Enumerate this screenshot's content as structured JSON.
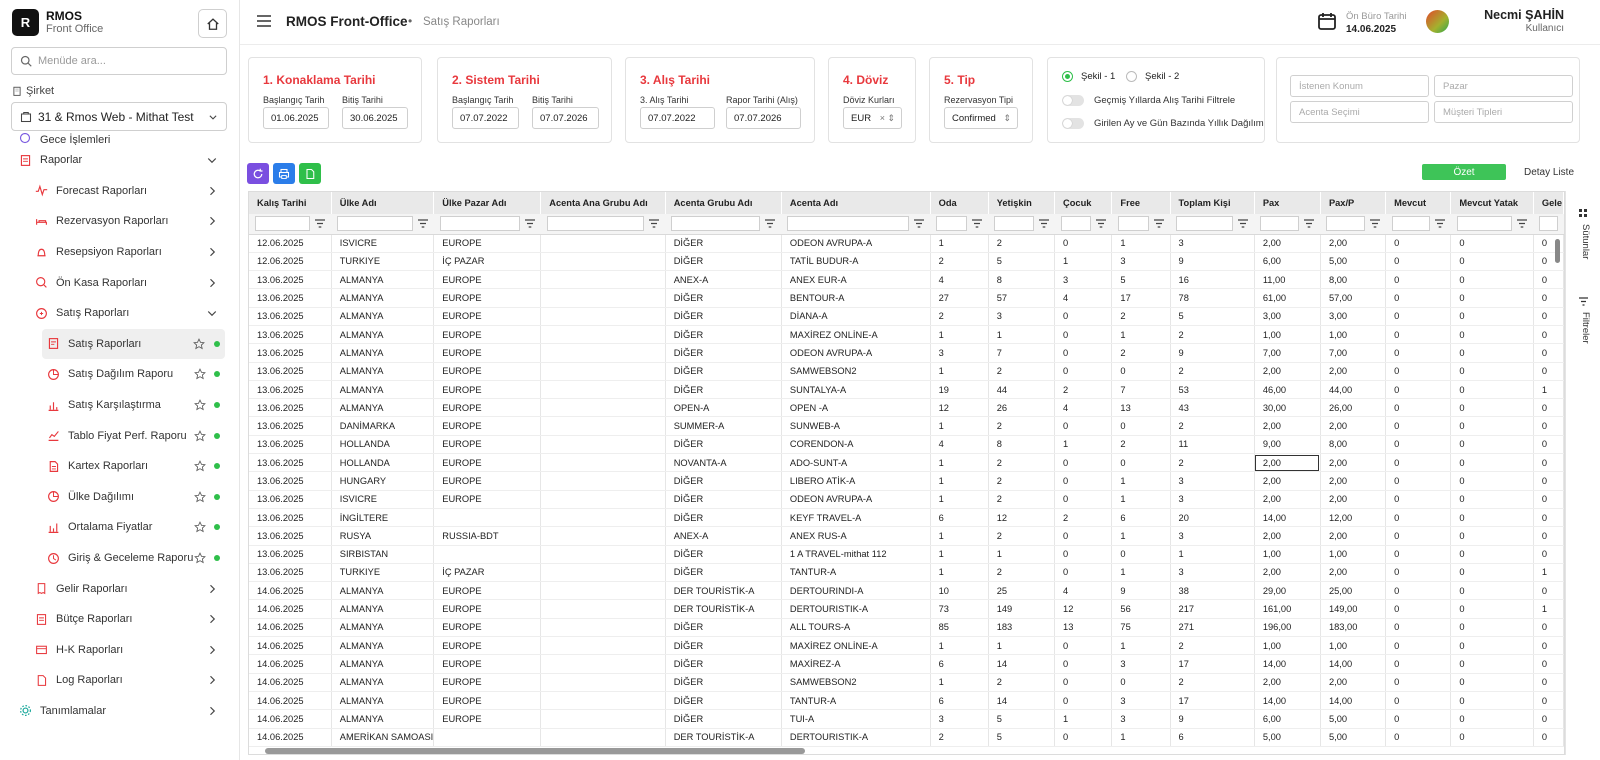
{
  "brand": {
    "logo_letter": "R",
    "title": "RMOS",
    "subtitle": "Front Office"
  },
  "sidebar": {
    "search_placeholder": "Menüde ara...",
    "company_label": "Şirket",
    "company_value": "31 & Rmos Web - Mithat Test",
    "partial_item": "Gece İşlemleri",
    "items": [
      {
        "label": "Raporlar",
        "icon": "report-icon"
      },
      {
        "label": "Forecast Raporları",
        "icon": "chart-line-icon"
      },
      {
        "label": "Rezervasyon Raporları",
        "icon": "bed-icon"
      },
      {
        "label": "Resepsiyon Raporları",
        "icon": "bell-icon"
      },
      {
        "label": "Ön Kasa Raporları",
        "icon": "cash-icon"
      },
      {
        "label": "Satış Raporları",
        "icon": "sales-icon"
      },
      {
        "label": "Satış Raporları",
        "icon": "report-doc-icon"
      },
      {
        "label": "Satış Dağılım Raporu",
        "icon": "pie-icon"
      },
      {
        "label": "Satış Karşılaştırma",
        "icon": "bar-chart-icon"
      },
      {
        "label": "Tablo Fiyat Perf. Raporu",
        "icon": "line-chart-icon"
      },
      {
        "label": "Kartex Raporları",
        "icon": "doc-icon"
      },
      {
        "label": "Ülke Dağılımı",
        "icon": "pie-icon"
      },
      {
        "label": "Ortalama Fiyatlar",
        "icon": "bar-chart-icon"
      },
      {
        "label": "Giriş & Geceleme Raporu",
        "icon": "clock-icon"
      },
      {
        "label": "Gelir Raporları",
        "icon": "receipt-icon"
      },
      {
        "label": "Bütçe Raporları",
        "icon": "wallet-icon"
      },
      {
        "label": "H-K Raporları",
        "icon": "broom-icon"
      },
      {
        "label": "Log Raporları",
        "icon": "log-icon"
      },
      {
        "label": "Tanımlamalar",
        "icon": "gear-icon"
      }
    ]
  },
  "header": {
    "title": "RMOS Front-Office",
    "separator": "•",
    "subtitle": "Satış Raporları",
    "onburo_label": "Ön Büro Tarihi",
    "onburo_date": "14.06.2025",
    "user_name": "Necmi ŞAHİN",
    "user_role": "Kullanıcı"
  },
  "filters": {
    "konaklama": {
      "title": "1. Konaklama Tarihi",
      "start_label": "Başlangıç Tarih",
      "start": "01.06.2025",
      "end_label": "Bitiş Tarihi",
      "end": "30.06.2025"
    },
    "sistem": {
      "title": "2. Sistem Tarihi",
      "start_label": "Başlangıç Tarih",
      "start": "07.07.2022",
      "end_label": "Bitiş Tarihi",
      "end": "07.07.2026"
    },
    "alis": {
      "title": "3. Alış Tarihi",
      "start_label": "3. Alış Tarihi",
      "start": "07.07.2022",
      "end_label": "Rapor Tarihi (Alış)",
      "end": "07.07.2026"
    },
    "doviz": {
      "title": "4. Döviz",
      "label": "Döviz Kurları",
      "value": "EUR"
    },
    "tip": {
      "title": "5. Tip",
      "label": "Rezervasyon Tipi",
      "value": "Confirmed"
    },
    "sekil1": "Şekil - 1",
    "sekil2": "Şekil - 2",
    "toggle1": "Geçmiş Yıllarda Alış Tarihi Filtrele",
    "toggle2": "Girilen Ay ve Gün Bazında Yıllık Dağılım",
    "istenen_konum": "İstenen Konum",
    "pazar": "Pazar",
    "acenta_secimi": "Acenta Seçimi",
    "musteri_tipleri": "Müşteri Tipleri"
  },
  "tabs": {
    "ozet": "Özet",
    "detay": "Detay Liste"
  },
  "side_tools": {
    "columns": "Sütunlar",
    "filters": "Filtreler"
  },
  "table": {
    "columns": [
      "Kalış Tarihi",
      "Ülke Adı",
      "Ülke Pazar Adı",
      "Acenta Ana Grubu Adı",
      "Acenta Grubu Adı",
      "Acenta Adı",
      "Oda",
      "Yetişkin",
      "Çocuk",
      "Free",
      "Toplam Kişi",
      "Pax",
      "Pax/P",
      "Mevcut",
      "Mevcut Yatak",
      "Gele"
    ],
    "rows": [
      [
        "12.06.2025",
        "ISVICRE",
        "EUROPE",
        "",
        "DİĞER",
        "ODEON AVRUPA-A",
        "1",
        "2",
        "0",
        "1",
        "3",
        "2,00",
        "2,00",
        "0",
        "0",
        "0"
      ],
      [
        "12.06.2025",
        "TURKIYE",
        "İÇ PAZAR",
        "",
        "DİĞER",
        "TATİL BUDUR-A",
        "2",
        "5",
        "1",
        "3",
        "9",
        "6,00",
        "5,00",
        "0",
        "0",
        "0"
      ],
      [
        "13.06.2025",
        "ALMANYA",
        "EUROPE",
        "",
        "ANEX-A",
        "ANEX EUR-A",
        "4",
        "8",
        "3",
        "5",
        "16",
        "11,00",
        "8,00",
        "0",
        "0",
        "0"
      ],
      [
        "13.06.2025",
        "ALMANYA",
        "EUROPE",
        "",
        "DİĞER",
        "BENTOUR-A",
        "27",
        "57",
        "4",
        "17",
        "78",
        "61,00",
        "57,00",
        "0",
        "0",
        "0"
      ],
      [
        "13.06.2025",
        "ALMANYA",
        "EUROPE",
        "",
        "DİĞER",
        "DİANA-A",
        "2",
        "3",
        "0",
        "2",
        "5",
        "3,00",
        "3,00",
        "0",
        "0",
        "0"
      ],
      [
        "13.06.2025",
        "ALMANYA",
        "EUROPE",
        "",
        "DİĞER",
        "MAXİREZ ONLİNE-A",
        "1",
        "1",
        "0",
        "1",
        "2",
        "1,00",
        "1,00",
        "0",
        "0",
        "0"
      ],
      [
        "13.06.2025",
        "ALMANYA",
        "EUROPE",
        "",
        "DİĞER",
        "ODEON AVRUPA-A",
        "3",
        "7",
        "0",
        "2",
        "9",
        "7,00",
        "7,00",
        "0",
        "0",
        "0"
      ],
      [
        "13.06.2025",
        "ALMANYA",
        "EUROPE",
        "",
        "DİĞER",
        "SAMWEBSON2",
        "1",
        "2",
        "0",
        "0",
        "2",
        "2,00",
        "2,00",
        "0",
        "0",
        "0"
      ],
      [
        "13.06.2025",
        "ALMANYA",
        "EUROPE",
        "",
        "DİĞER",
        "SUNTALYA-A",
        "19",
        "44",
        "2",
        "7",
        "53",
        "46,00",
        "44,00",
        "0",
        "0",
        "1"
      ],
      [
        "13.06.2025",
        "ALMANYA",
        "EUROPE",
        "",
        "OPEN-A",
        "OPEN -A",
        "12",
        "26",
        "4",
        "13",
        "43",
        "30,00",
        "26,00",
        "0",
        "0",
        "0"
      ],
      [
        "13.06.2025",
        "DANİMARKA",
        "EUROPE",
        "",
        "SUMMER-A",
        "SUNWEB-A",
        "1",
        "2",
        "0",
        "0",
        "2",
        "2,00",
        "2,00",
        "0",
        "0",
        "0"
      ],
      [
        "13.06.2025",
        "HOLLANDA",
        "EUROPE",
        "",
        "DİĞER",
        "CORENDON-A",
        "4",
        "8",
        "1",
        "2",
        "11",
        "9,00",
        "8,00",
        "0",
        "0",
        "0"
      ],
      [
        "13.06.2025",
        "HOLLANDA",
        "EUROPE",
        "",
        "NOVANTA-A",
        "ADO-SUNT-A",
        "1",
        "2",
        "0",
        "0",
        "2",
        "2,00",
        "2,00",
        "0",
        "0",
        "0"
      ],
      [
        "13.06.2025",
        "HUNGARY",
        "EUROPE",
        "",
        "DİĞER",
        "LIBERO ATİK-A",
        "1",
        "2",
        "0",
        "1",
        "3",
        "2,00",
        "2,00",
        "0",
        "0",
        "0"
      ],
      [
        "13.06.2025",
        "ISVICRE",
        "EUROPE",
        "",
        "DİĞER",
        "ODEON AVRUPA-A",
        "1",
        "2",
        "0",
        "1",
        "3",
        "2,00",
        "2,00",
        "0",
        "0",
        "0"
      ],
      [
        "13.06.2025",
        "İNGİLTERE",
        "",
        "",
        "DİĞER",
        "KEYF TRAVEL-A",
        "6",
        "12",
        "2",
        "6",
        "20",
        "14,00",
        "12,00",
        "0",
        "0",
        "0"
      ],
      [
        "13.06.2025",
        "RUSYA",
        "RUSSIA-BDT",
        "",
        "ANEX-A",
        "ANEX RUS-A",
        "1",
        "2",
        "0",
        "1",
        "3",
        "2,00",
        "2,00",
        "0",
        "0",
        "0"
      ],
      [
        "13.06.2025",
        "SIRBISTAN",
        "",
        "",
        "DİĞER",
        "1 A TRAVEL-mithat 112",
        "1",
        "1",
        "0",
        "0",
        "1",
        "1,00",
        "1,00",
        "0",
        "0",
        "0"
      ],
      [
        "13.06.2025",
        "TURKIYE",
        "İÇ PAZAR",
        "",
        "DİĞER",
        "TANTUR-A",
        "1",
        "2",
        "0",
        "1",
        "3",
        "2,00",
        "2,00",
        "0",
        "0",
        "1"
      ],
      [
        "14.06.2025",
        "ALMANYA",
        "EUROPE",
        "",
        "DER TOURİSTİK-A",
        "DERTOURINDI-A",
        "10",
        "25",
        "4",
        "9",
        "38",
        "29,00",
        "25,00",
        "0",
        "0",
        "0"
      ],
      [
        "14.06.2025",
        "ALMANYA",
        "EUROPE",
        "",
        "DER TOURİSTİK-A",
        "DERTOURISTIK-A",
        "73",
        "149",
        "12",
        "56",
        "217",
        "161,00",
        "149,00",
        "0",
        "0",
        "1"
      ],
      [
        "14.06.2025",
        "ALMANYA",
        "EUROPE",
        "",
        "DİĞER",
        "ALL TOURS-A",
        "85",
        "183",
        "13",
        "75",
        "271",
        "196,00",
        "183,00",
        "0",
        "0",
        "0"
      ],
      [
        "14.06.2025",
        "ALMANYA",
        "EUROPE",
        "",
        "DİĞER",
        "MAXİREZ ONLİNE-A",
        "1",
        "1",
        "0",
        "1",
        "2",
        "1,00",
        "1,00",
        "0",
        "0",
        "0"
      ],
      [
        "14.06.2025",
        "ALMANYA",
        "EUROPE",
        "",
        "DİĞER",
        "MAXİREZ-A",
        "6",
        "14",
        "0",
        "3",
        "17",
        "14,00",
        "14,00",
        "0",
        "0",
        "0"
      ],
      [
        "14.06.2025",
        "ALMANYA",
        "EUROPE",
        "",
        "DİĞER",
        "SAMWEBSON2",
        "1",
        "2",
        "0",
        "0",
        "2",
        "2,00",
        "2,00",
        "0",
        "0",
        "0"
      ],
      [
        "14.06.2025",
        "ALMANYA",
        "EUROPE",
        "",
        "DİĞER",
        "TANTUR-A",
        "6",
        "14",
        "0",
        "3",
        "17",
        "14,00",
        "14,00",
        "0",
        "0",
        "0"
      ],
      [
        "14.06.2025",
        "ALMANYA",
        "EUROPE",
        "",
        "DİĞER",
        "TUI-A",
        "3",
        "5",
        "1",
        "3",
        "9",
        "6,00",
        "5,00",
        "0",
        "0",
        "0"
      ],
      [
        "14.06.2025",
        "AMERİKAN SAMOASI",
        "",
        "",
        "DER TOURİSTİK-A",
        "DERTOURISTIK-A",
        "2",
        "5",
        "0",
        "1",
        "6",
        "5,00",
        "5,00",
        "0",
        "0",
        "0"
      ]
    ],
    "selected_cell": "12.11"
  }
}
